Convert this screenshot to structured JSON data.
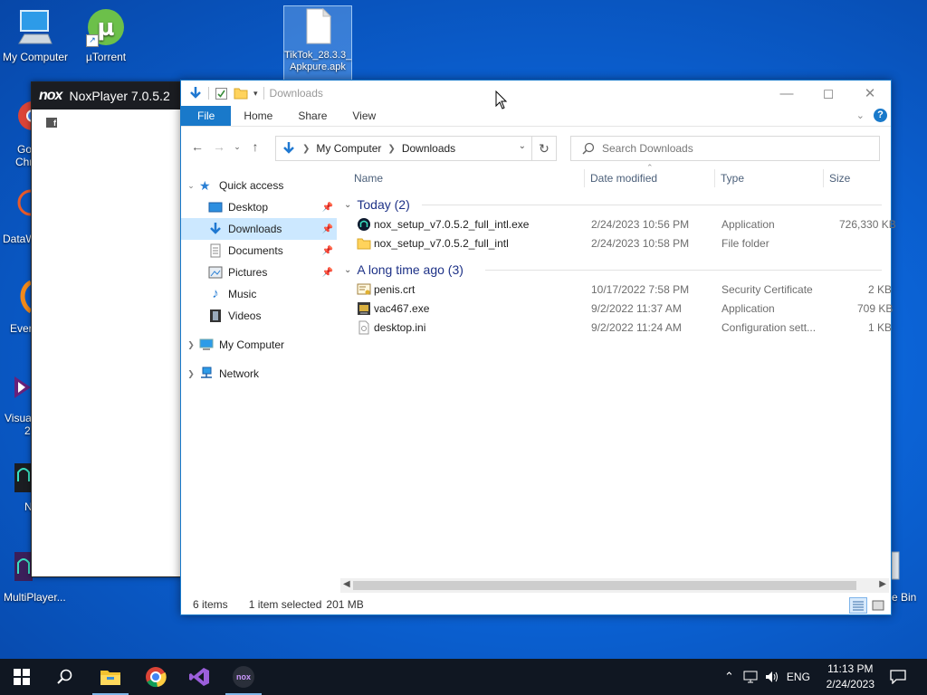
{
  "desktop": {
    "icons": [
      {
        "label": "My Computer"
      },
      {
        "label": "µTorrent"
      },
      {
        "label": "TikTok_28.3.3_ Apkpure.apk"
      }
    ],
    "partial_labels": {
      "chrome_1": "Go",
      "chrome_2": "Chr",
      "data": "DataW",
      "ever": "Ever",
      "visual_1": "Visua",
      "visual_2": "2",
      "n": "N",
      "multi": "MultiPlayer...",
      "bin": "e Bin"
    }
  },
  "nox": {
    "logo": "nox",
    "title": "NoxPlayer 7.0.5.2",
    "fb": "f"
  },
  "explorer": {
    "title": "Downloads",
    "ribbon": {
      "file": "File",
      "home": "Home",
      "share": "Share",
      "view": "View",
      "help": "?"
    },
    "address": {
      "root": "My Computer",
      "current": "Downloads"
    },
    "search_placeholder": "Search Downloads",
    "nav": {
      "quick_access": "Quick access",
      "desktop": "Desktop",
      "downloads": "Downloads",
      "documents": "Documents",
      "pictures": "Pictures",
      "music": "Music",
      "videos": "Videos",
      "my_computer": "My Computer",
      "network": "Network"
    },
    "columns": {
      "name": "Name",
      "date": "Date modified",
      "type": "Type",
      "size": "Size"
    },
    "groups": {
      "today": "Today (2)",
      "older": "A long time ago (3)"
    },
    "files_today": [
      {
        "name": "nox_setup_v7.0.5.2_full_intl.exe",
        "date": "2/24/2023 10:56 PM",
        "type": "Application",
        "size": "726,330 KB"
      },
      {
        "name": "nox_setup_v7.0.5.2_full_intl",
        "date": "2/24/2023 10:58 PM",
        "type": "File folder",
        "size": ""
      }
    ],
    "files_older": [
      {
        "name": "penis.crt",
        "date": "10/17/2022 7:58 PM",
        "type": "Security Certificate",
        "size": "2 KB"
      },
      {
        "name": "vac467.exe",
        "date": "9/2/2022 11:37 AM",
        "type": "Application",
        "size": "709 KB"
      },
      {
        "name": "desktop.ini",
        "date": "9/2/2022 11:24 AM",
        "type": "Configuration sett...",
        "size": "1 KB"
      }
    ],
    "status": {
      "items": "6 items",
      "selected": "1 item selected",
      "size": "201 MB"
    }
  },
  "taskbar": {
    "language": "ENG",
    "time": "11:13 PM",
    "date": "2/24/2023",
    "nox_label": "nox"
  }
}
